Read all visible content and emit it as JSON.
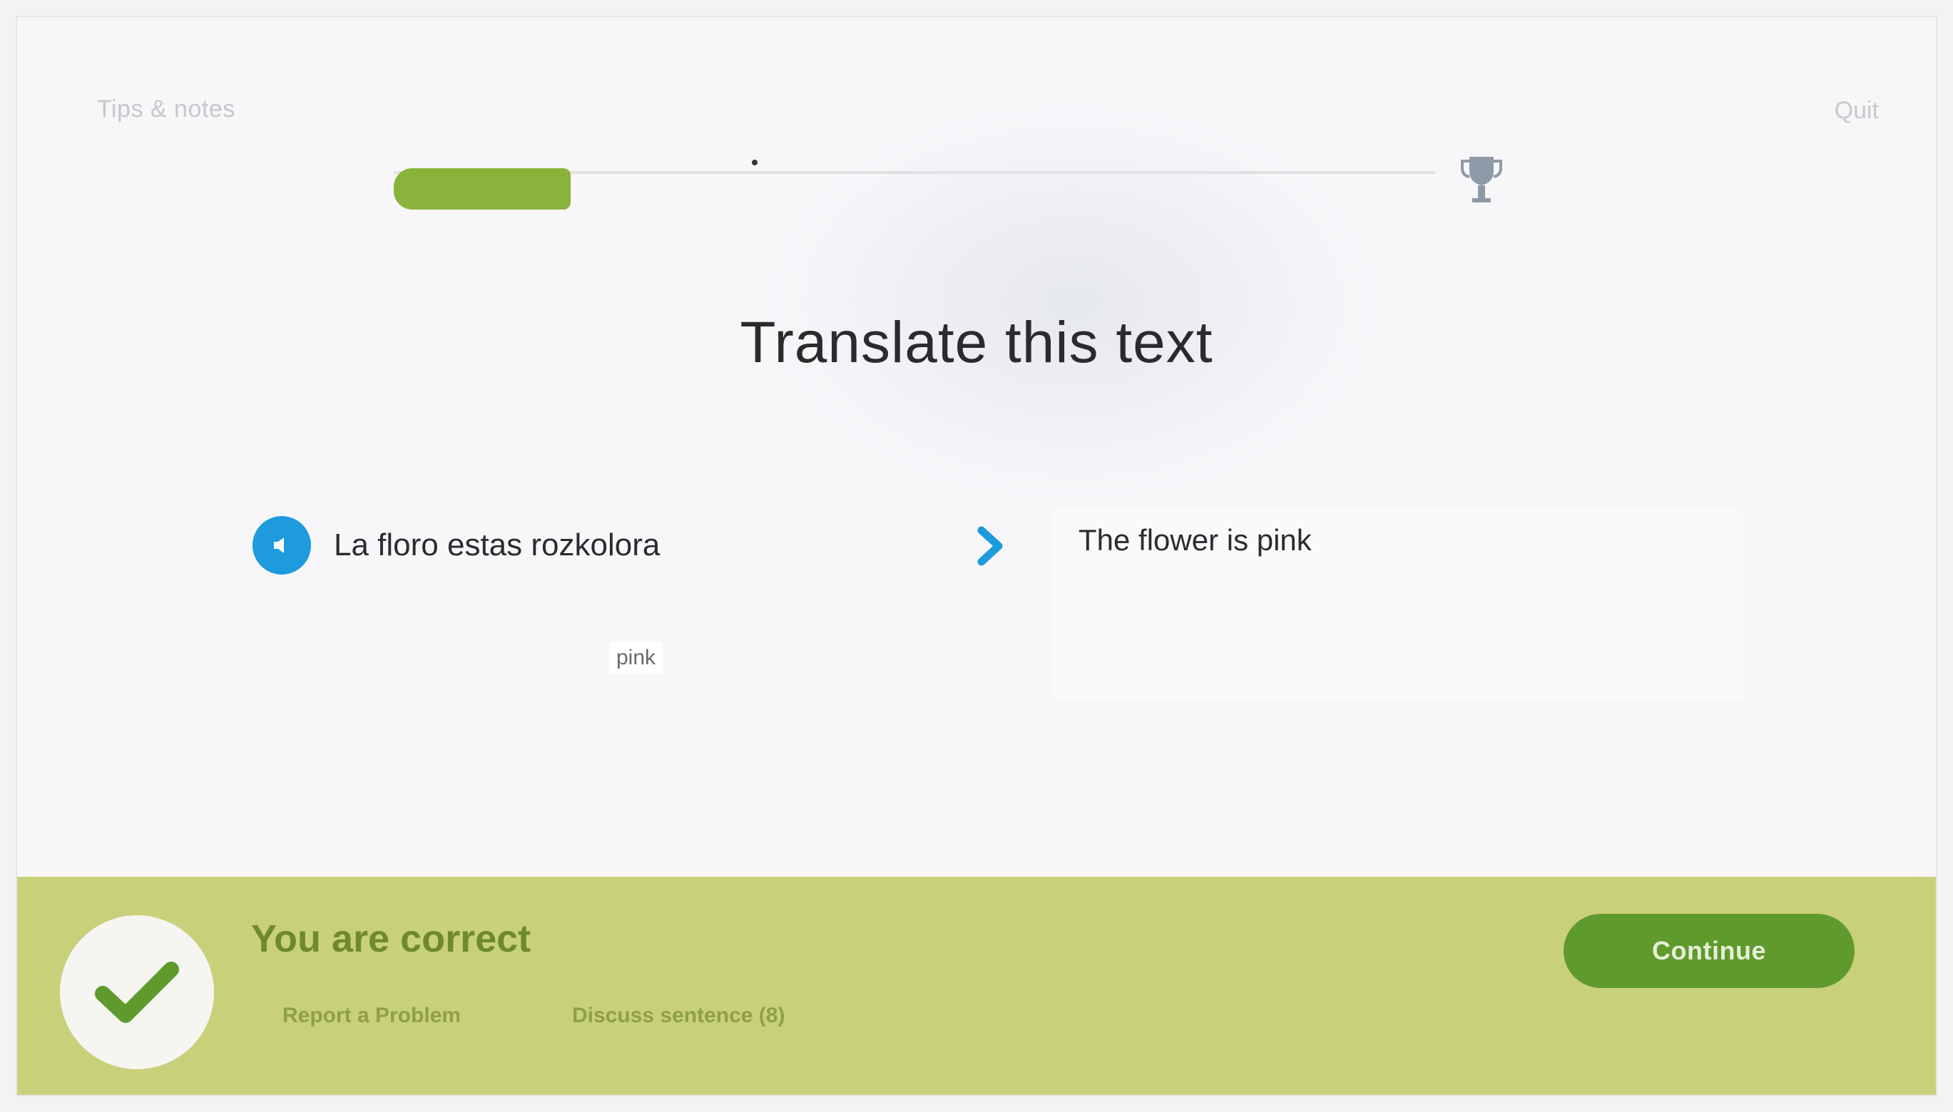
{
  "header": {
    "top_left_link": "Tips & notes",
    "top_right_link": "Quit"
  },
  "progress": {
    "value": 0.17
  },
  "prompt": {
    "title": "Translate this text"
  },
  "source": {
    "text": "La floro estas rozkolora",
    "hint_word": "pink"
  },
  "answer": {
    "text": "The flower is pink"
  },
  "footer": {
    "title": "You are correct",
    "report_label": "Report a Problem",
    "discuss_label": "Discuss sentence (8)",
    "continue_label": "Continue"
  },
  "colors": {
    "accent_green": "#89b33b",
    "footer_bg": "#c9d07a",
    "button_green": "#5f9a2d",
    "speaker_blue": "#1d9bdc"
  }
}
